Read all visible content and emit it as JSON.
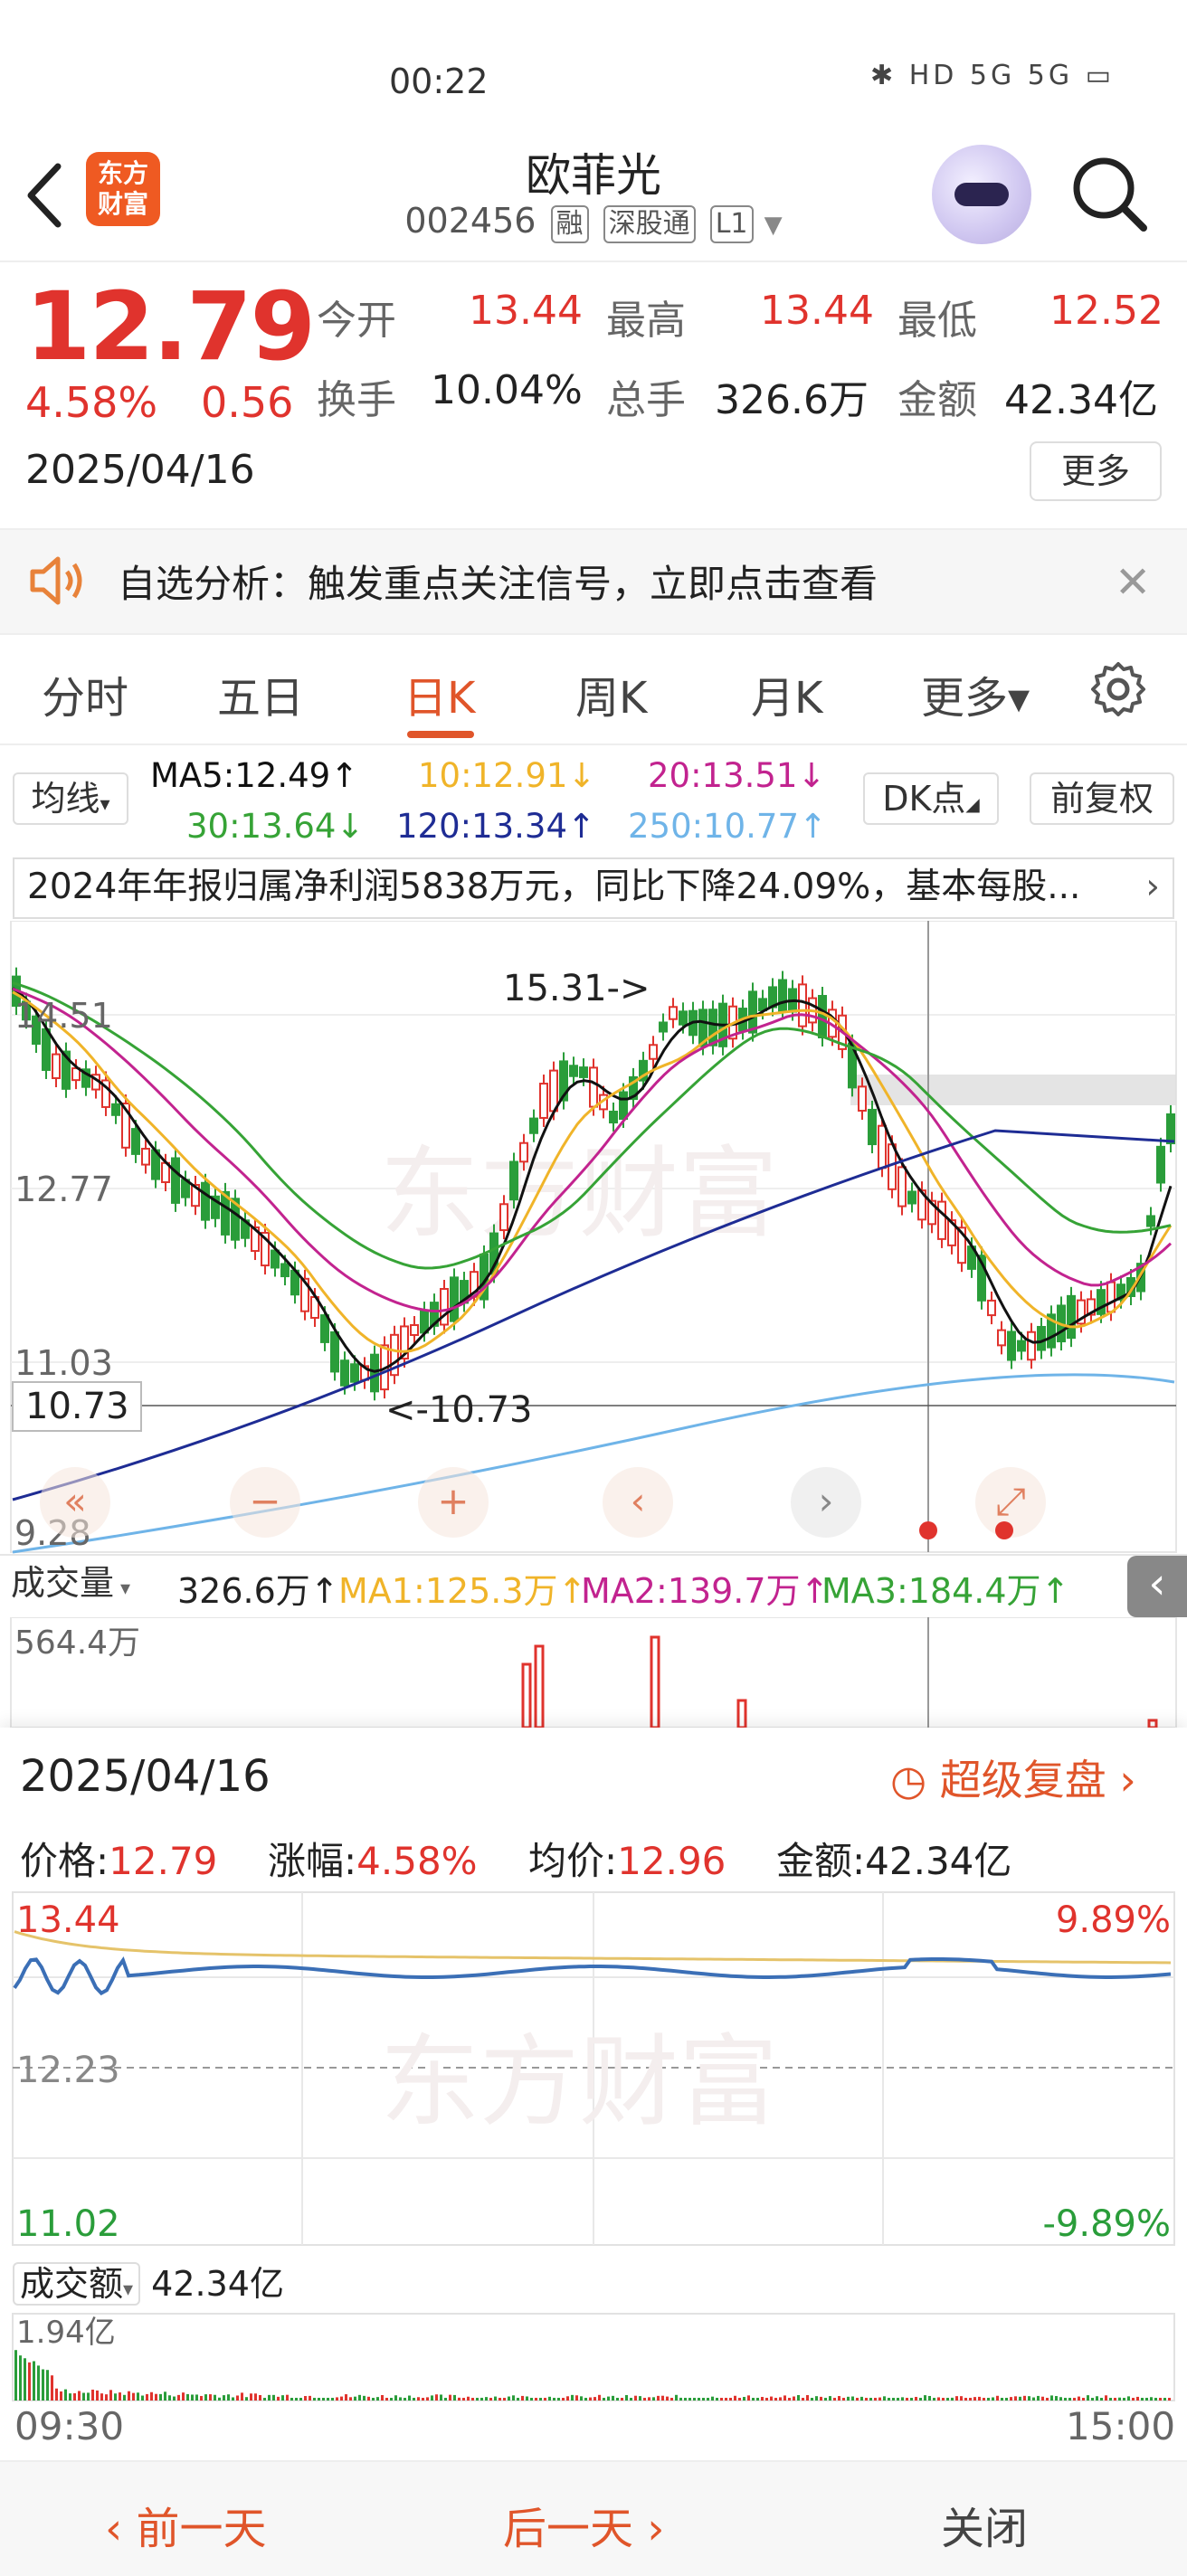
{
  "status": {
    "time": "00:22",
    "icons": "✱ HD 5G 5G ▭"
  },
  "header": {
    "logo_text_1": "东方",
    "logo_text_2": "财富",
    "stock_name": "欧菲光",
    "stock_code": "002456",
    "tags": [
      "融",
      "深股通",
      "L1"
    ]
  },
  "quote": {
    "price": "12.79",
    "change_pct": "4.58%",
    "change_amt": "0.56",
    "date": "2025/04/16",
    "fields": [
      {
        "label": "今开",
        "value": "13.44",
        "color": "#e0332d"
      },
      {
        "label": "最高",
        "value": "13.44",
        "color": "#e0332d"
      },
      {
        "label": "最低",
        "value": "12.52",
        "color": "#e0332d"
      },
      {
        "label": "换手",
        "value": "10.04%",
        "color": "#222222"
      },
      {
        "label": "总手",
        "value": "326.6万",
        "color": "#222222"
      },
      {
        "label": "金额",
        "value": "42.34亿",
        "color": "#222222"
      }
    ],
    "more_label": "更多"
  },
  "notice": {
    "text": "自选分析：触发重点关注信号，立即点击查看"
  },
  "tabs": [
    "分时",
    "五日",
    "日K",
    "周K",
    "月K",
    "更多▾"
  ],
  "active_tab": "日K",
  "ma": {
    "selector": "均线",
    "ma5": "MA5:12.49↑",
    "ma10": "10:12.91↓",
    "ma20": "20:13.51↓",
    "ma30": "30:13.64↓",
    "ma120": "120:13.34↑",
    "ma250": "250:10.77↑",
    "dk_label": "DK点",
    "adjust_label": "前复权"
  },
  "news": "2024年年报归属净利润5838万元，同比下降24.09%，基本每股...",
  "kchart": {
    "y_labels": [
      "14.51",
      "12.77",
      "11.03",
      "9.28"
    ],
    "high_annotation": "15.31->",
    "low_annotation": "<-10.73",
    "low_value_box": "10.73",
    "watermark": "东方财富"
  },
  "volume": {
    "selector": "成交量",
    "value": "326.6万↑",
    "ma1": "MA1:125.3万↑",
    "ma2": "MA2:139.7万↑",
    "ma3": "MA3:184.4万↑",
    "axis_top": "564.4万"
  },
  "detail": {
    "date": "2025/04/16",
    "replay_label": "超级复盘",
    "price_label": "价格:",
    "price_value": "12.79",
    "pct_label": "涨幅:",
    "pct_value": "4.58%",
    "avg_label": "均价:",
    "avg_value": "12.96",
    "amount": "金额:42.34亿",
    "intraday_top": "13.44",
    "intraday_mid": "12.23",
    "intraday_bottom": "11.02",
    "pct_top": "9.89%",
    "pct_bottom": "-9.89%",
    "turnover_selector": "成交额",
    "turnover_value": "42.34亿",
    "turnover_axis": "1.94亿",
    "time_start": "09:30",
    "time_end": "15:00"
  },
  "bottom": {
    "prev": "前一天",
    "next": "后一天",
    "close": "关闭"
  },
  "colors": {
    "up": "#e0332d",
    "down": "#2a9d3a",
    "accent": "#e0552a",
    "ma5": "#111111",
    "ma10": "#f0b429",
    "ma20": "#c2238f",
    "ma30": "#36a336",
    "ma120": "#1e2c94",
    "ma250": "#6fb4e8"
  }
}
